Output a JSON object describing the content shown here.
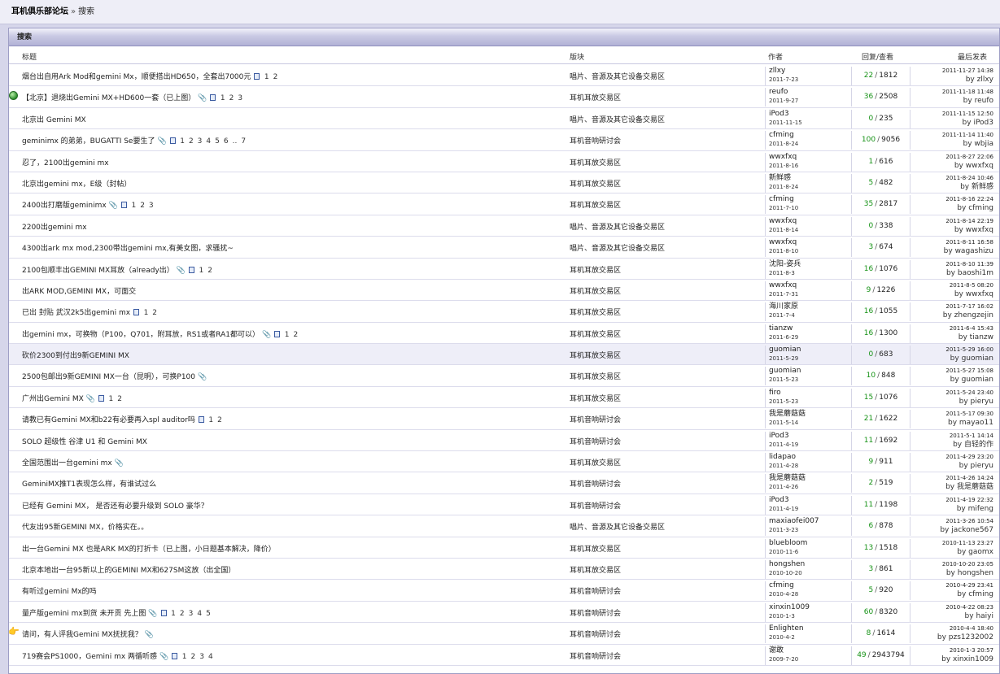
{
  "breadcrumb": {
    "home": "耳机俱乐部论坛",
    "sep": "»",
    "current": "搜索"
  },
  "box_title": "搜索",
  "columns": {
    "title": "标题",
    "forum": "版块",
    "author": "作者",
    "stats": "回复/查看",
    "last": "最后发表"
  },
  "rows": [
    {
      "title": "烟台出自用Ark Mod和gemini Mx，顺便搭出HD650，全套出7000元",
      "forum": "唱片、音源及其它设备交易区",
      "author": "zllxy",
      "date": "2011-7-23",
      "replies": "22",
      "views": "1812",
      "last_time": "2011-11-27 14:38",
      "last_by": "zllxy",
      "pages": [
        "1",
        "2"
      ],
      "attach": false
    },
    {
      "title": "【北京】退烧出Gemini MX+HD600一套（已上图）",
      "forum": "耳机耳放交易区",
      "author": "reufo",
      "date": "2011-9-27",
      "replies": "36",
      "views": "2508",
      "last_time": "2011-11-18 11:48",
      "last_by": "reufo",
      "pages": [
        "1",
        "2",
        "3"
      ],
      "attach": true,
      "icon": "globe"
    },
    {
      "title": "北京出 Gemini MX",
      "forum": "唱片、音源及其它设备交易区",
      "author": "iPod3",
      "date": "2011-11-15",
      "replies": "0",
      "views": "235",
      "last_time": "2011-11-15 12:50",
      "last_by": "iPod3",
      "pages": [],
      "attach": false
    },
    {
      "title": "geminimx 的弟弟，BUGATTI Se要生了",
      "forum": "耳机音响研讨会",
      "author": "cfming",
      "date": "2011-8-24",
      "replies": "100",
      "views": "9056",
      "last_time": "2011-11-14 11:40",
      "last_by": "wbjia",
      "pages": [
        "1",
        "2",
        "3",
        "4",
        "5",
        "6",
        "..",
        "7"
      ],
      "attach": true
    },
    {
      "title": "忍了，2100出gemini mx",
      "forum": "耳机耳放交易区",
      "author": "wwxfxq",
      "date": "2011-8-16",
      "replies": "1",
      "views": "616",
      "last_time": "2011-8-27 22:06",
      "last_by": "wwxfxq",
      "pages": [],
      "attach": false
    },
    {
      "title": "北京出gemini mx，E级（封帖）",
      "forum": "耳机耳放交易区",
      "author": "新鲜感",
      "date": "2011-8-24",
      "replies": "5",
      "views": "482",
      "last_time": "2011-8-24 10:46",
      "last_by": "新鲜感",
      "pages": [],
      "attach": false
    },
    {
      "title": "2400出打磨版geminimx",
      "forum": "耳机耳放交易区",
      "author": "cfming",
      "date": "2011-7-10",
      "replies": "35",
      "views": "2817",
      "last_time": "2011-8-16 22:24",
      "last_by": "cfming",
      "pages": [
        "1",
        "2",
        "3"
      ],
      "attach": true
    },
    {
      "title": "2200出gemini mx",
      "forum": "唱片、音源及其它设备交易区",
      "author": "wwxfxq",
      "date": "2011-8-14",
      "replies": "0",
      "views": "338",
      "last_time": "2011-8-14 22:19",
      "last_by": "wwxfxq",
      "pages": [],
      "attach": false
    },
    {
      "title": "4300出ark mx mod,2300带出gemini mx,有美女图，求骚扰~",
      "forum": "唱片、音源及其它设备交易区",
      "author": "wwxfxq",
      "date": "2011-8-10",
      "replies": "3",
      "views": "674",
      "last_time": "2011-8-11 16:58",
      "last_by": "wagashizu",
      "pages": [],
      "attach": false
    },
    {
      "title": "2100包顺丰出GEMINI MX耳放（already出）",
      "forum": "耳机耳放交易区",
      "author": "沈阳-姿兵",
      "date": "2011-8-3",
      "replies": "16",
      "views": "1076",
      "last_time": "2011-8-10 11:39",
      "last_by": "baoshi1m",
      "pages": [
        "1",
        "2"
      ],
      "attach": true
    },
    {
      "title": "出ARK MOD,GEMINI MX，可面交",
      "forum": "耳机耳放交易区",
      "author": "wwxfxq",
      "date": "2011-7-31",
      "replies": "9",
      "views": "1226",
      "last_time": "2011-8-5 08:20",
      "last_by": "wwxfxq",
      "pages": [],
      "attach": false
    },
    {
      "title": "已出 封贴 武汉2k5出gemini mx",
      "forum": "耳机耳放交易区",
      "author": "海川家原",
      "date": "2011-7-4",
      "replies": "16",
      "views": "1055",
      "last_time": "2011-7-17 16:02",
      "last_by": "zhengzejin",
      "pages": [
        "1",
        "2"
      ],
      "attach": false
    },
    {
      "title": "出gemini mx，可换物（P100，Q701，附耳放，RS1或者RA1都可以）",
      "forum": "耳机耳放交易区",
      "author": "tianzw",
      "date": "2011-6-29",
      "replies": "16",
      "views": "1300",
      "last_time": "2011-6-4 15:43",
      "last_by": "tianzw",
      "pages": [
        "1",
        "2"
      ],
      "attach": true
    },
    {
      "title": "砍价2300到付出9新GEMINI MX",
      "forum": "耳机耳放交易区",
      "author": "guomian",
      "date": "2011-5-29",
      "replies": "0",
      "views": "683",
      "last_time": "2011-5-29 16:00",
      "last_by": "guomian",
      "pages": [],
      "attach": false,
      "hl": true
    },
    {
      "title": "2500包邮出9新GEMINI MX一台（昆明），可换P100",
      "forum": "耳机耳放交易区",
      "author": "guomian",
      "date": "2011-5-23",
      "replies": "10",
      "views": "848",
      "last_time": "2011-5-27 15:08",
      "last_by": "guomian",
      "pages": [],
      "attach": true
    },
    {
      "title": "广州出Gemini MX",
      "forum": "耳机耳放交易区",
      "author": "firo",
      "date": "2011-5-23",
      "replies": "15",
      "views": "1076",
      "last_time": "2011-5-24 23:40",
      "last_by": "pieryu",
      "pages": [
        "1",
        "2"
      ],
      "attach": true
    },
    {
      "title": "请教已有Gemini MX和b22有必要再入spl auditor吗",
      "forum": "耳机音响研讨会",
      "author": "我是蘑菇菇",
      "date": "2011-5-14",
      "replies": "21",
      "views": "1622",
      "last_time": "2011-5-17 09:30",
      "last_by": "mayao11",
      "pages": [
        "1",
        "2"
      ],
      "attach": false
    },
    {
      "title": "SOLO 超级性 谷津 U1 和 Gemini MX",
      "forum": "耳机音响研讨会",
      "author": "iPod3",
      "date": "2011-4-19",
      "replies": "11",
      "views": "1692",
      "last_time": "2011-5-1 14:14",
      "last_by": "自轻的作",
      "pages": [],
      "attach": false
    },
    {
      "title": "全国范围出一台gemini mx",
      "forum": "耳机耳放交易区",
      "author": "lidapao",
      "date": "2011-4-28",
      "replies": "9",
      "views": "911",
      "last_time": "2011-4-29 23:20",
      "last_by": "pieryu",
      "pages": [],
      "attach": true
    },
    {
      "title": "GeminiMX推T1表现怎么样，有谁试过么",
      "forum": "耳机音响研讨会",
      "author": "我是蘑菇菇",
      "date": "2011-4-26",
      "replies": "2",
      "views": "519",
      "last_time": "2011-4-26 14:24",
      "last_by": "我是蘑菇菇",
      "pages": [],
      "attach": false
    },
    {
      "title": "已经有 Gemini MX， 是否还有必要升级到 SOLO 豪华？",
      "forum": "耳机音响研讨会",
      "author": "iPod3",
      "date": "2011-4-19",
      "replies": "11",
      "views": "1198",
      "last_time": "2011-4-19 22:32",
      "last_by": "mifeng",
      "pages": [],
      "attach": false
    },
    {
      "title": "代友出95新GEMINI MX，价格实在。。",
      "forum": "唱片、音源及其它设备交易区",
      "author": "maxiaofei007",
      "date": "2011-3-23",
      "replies": "6",
      "views": "878",
      "last_time": "2011-3-26 10:54",
      "last_by": "jackone567",
      "pages": [],
      "attach": false
    },
    {
      "title": "出一台Gemini MX 也是ARK MX的打折卡（已上图，小日题基本解决，降价）",
      "forum": "耳机耳放交易区",
      "author": "bluebloom",
      "date": "2010-11-6",
      "replies": "13",
      "views": "1518",
      "last_time": "2010-11-13 23:27",
      "last_by": "gaomx",
      "pages": [],
      "attach": false
    },
    {
      "title": "北京本地出一台95新以上的GEMINI MX和627SM这放（出全国）",
      "forum": "耳机耳放交易区",
      "author": "hongshen",
      "date": "2010-10-20",
      "replies": "3",
      "views": "861",
      "last_time": "2010-10-20 23:05",
      "last_by": "hongshen",
      "pages": [],
      "attach": false
    },
    {
      "title": "有听过gemini Mx的吗",
      "forum": "耳机音响研讨会",
      "author": "cfming",
      "date": "2010-4-28",
      "replies": "5",
      "views": "920",
      "last_time": "2010-4-29 23:41",
      "last_by": "cfming",
      "pages": [],
      "attach": false
    },
    {
      "title": "量产版gemini mx到货 未开贡 先上图",
      "forum": "耳机音响研讨会",
      "author": "xinxin1009",
      "date": "2010-1-3",
      "replies": "60",
      "views": "8320",
      "last_time": "2010-4-22 08:23",
      "last_by": "haiyi",
      "pages": [
        "1",
        "2",
        "3",
        "4",
        "5"
      ],
      "attach": true
    },
    {
      "title": "请问，有人评我Gemini MX抚抚我？",
      "forum": "耳机音响研讨会",
      "author": "Enlighten",
      "date": "2010-4-2",
      "replies": "8",
      "views": "1614",
      "last_time": "2010-4-4 18:40",
      "last_by": "pzs1232002",
      "pages": [],
      "attach": true,
      "icon": "hand"
    },
    {
      "title": "719赛会PS1000，Gemini mx 两循听感",
      "forum": "耳机音响研讨会",
      "author": "谢敢",
      "date": "2009-7-20",
      "replies": "49",
      "views": "2943794",
      "last_time": "2010-1-3 20:57",
      "last_by": "xinxin1009",
      "pages": [
        "1",
        "2",
        "3",
        "4"
      ],
      "attach": true
    }
  ]
}
